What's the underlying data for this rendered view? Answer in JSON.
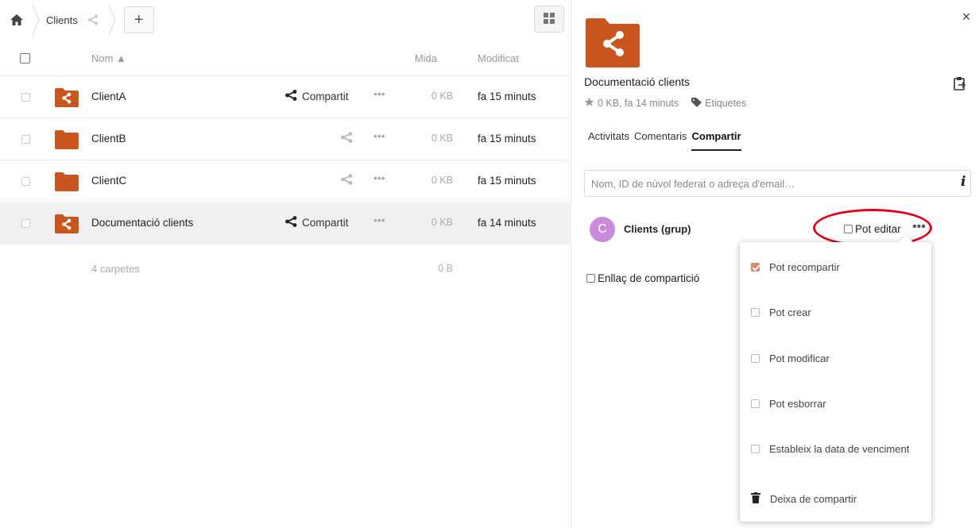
{
  "breadcrumb": {
    "home_icon": "home-icon",
    "folder": "Clients",
    "add": "+"
  },
  "table": {
    "header": {
      "name": "Nom ▲",
      "size": "Mida",
      "modified": "Modificat"
    },
    "rows": [
      {
        "name": "ClientA",
        "shared_label": "Compartit",
        "more": "•••",
        "size": "0 KB",
        "modified": "fa 15 minuts",
        "shared": true
      },
      {
        "name": "ClientB",
        "shared_label": "",
        "more": "•••",
        "size": "0 KB",
        "modified": "fa 15 minuts",
        "shared": false
      },
      {
        "name": "ClientC",
        "shared_label": "",
        "more": "•••",
        "size": "0 KB",
        "modified": "fa 15 minuts",
        "shared": false
      },
      {
        "name": "Documentació clients",
        "shared_label": "Compartit",
        "more": "•••",
        "size": "0 KB",
        "modified": "fa 14 minuts",
        "shared": true
      }
    ],
    "summary": {
      "label": "4 carpetes",
      "size": "0 B"
    }
  },
  "sidebar": {
    "close": "×",
    "title": "Documentació clients",
    "meta": "0 KB, fa 14 minuts",
    "tags": "Etiquetes",
    "tabs": [
      "Activitats",
      "Comentaris",
      "Compartir"
    ],
    "active_tab": "Compartir",
    "share_placeholder": "Nom, ID de núvol federat o adreça d'email…",
    "info": "i",
    "sharee": {
      "initial": "C",
      "name": "Clients (grup)",
      "can_edit": "Pot editar",
      "more": "•••"
    },
    "link_share": "Enllaç de compartició",
    "menu": [
      {
        "label": "Pot recompartir",
        "checked": true
      },
      {
        "label": "Pot crear",
        "checked": false
      },
      {
        "label": "Pot modificar",
        "checked": false
      },
      {
        "label": "Pot esborrar",
        "checked": false
      },
      {
        "label": "Estableix la data de venciment",
        "checked": false
      }
    ],
    "unshare": "Deixa de compartir"
  },
  "colors": {
    "folder": "#c9561f",
    "accent_check": "#d98a6a",
    "avatar": "#c98bda",
    "highlight": "#e1001b"
  }
}
